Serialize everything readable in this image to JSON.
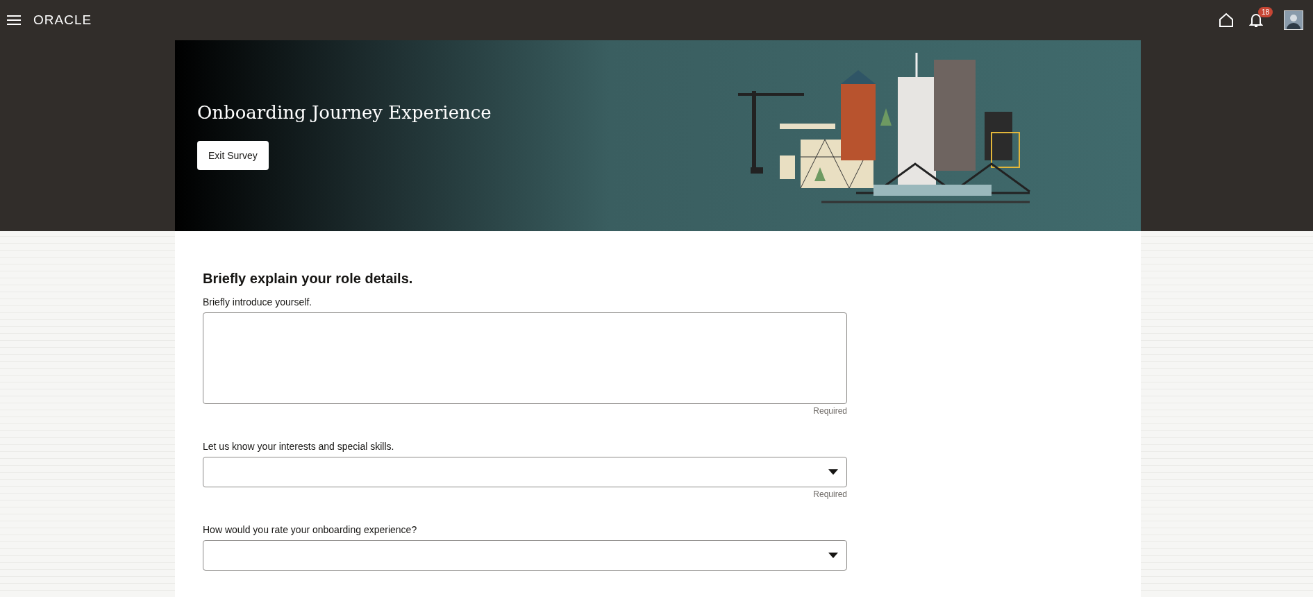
{
  "header": {
    "logo": "ORACLE",
    "notification_count": "18"
  },
  "banner": {
    "title": "Onboarding Journey Experience",
    "button": "Exit Survey"
  },
  "section": {
    "title": "Briefly explain your role details."
  },
  "questions": [
    {
      "kind": "textarea",
      "label": "Briefly introduce yourself.",
      "helper": "Required"
    },
    {
      "kind": "select",
      "label": "Let us know your interests and special skills.",
      "helper": "Required"
    },
    {
      "kind": "select",
      "label": "How would you rate your onboarding experience?"
    }
  ]
}
